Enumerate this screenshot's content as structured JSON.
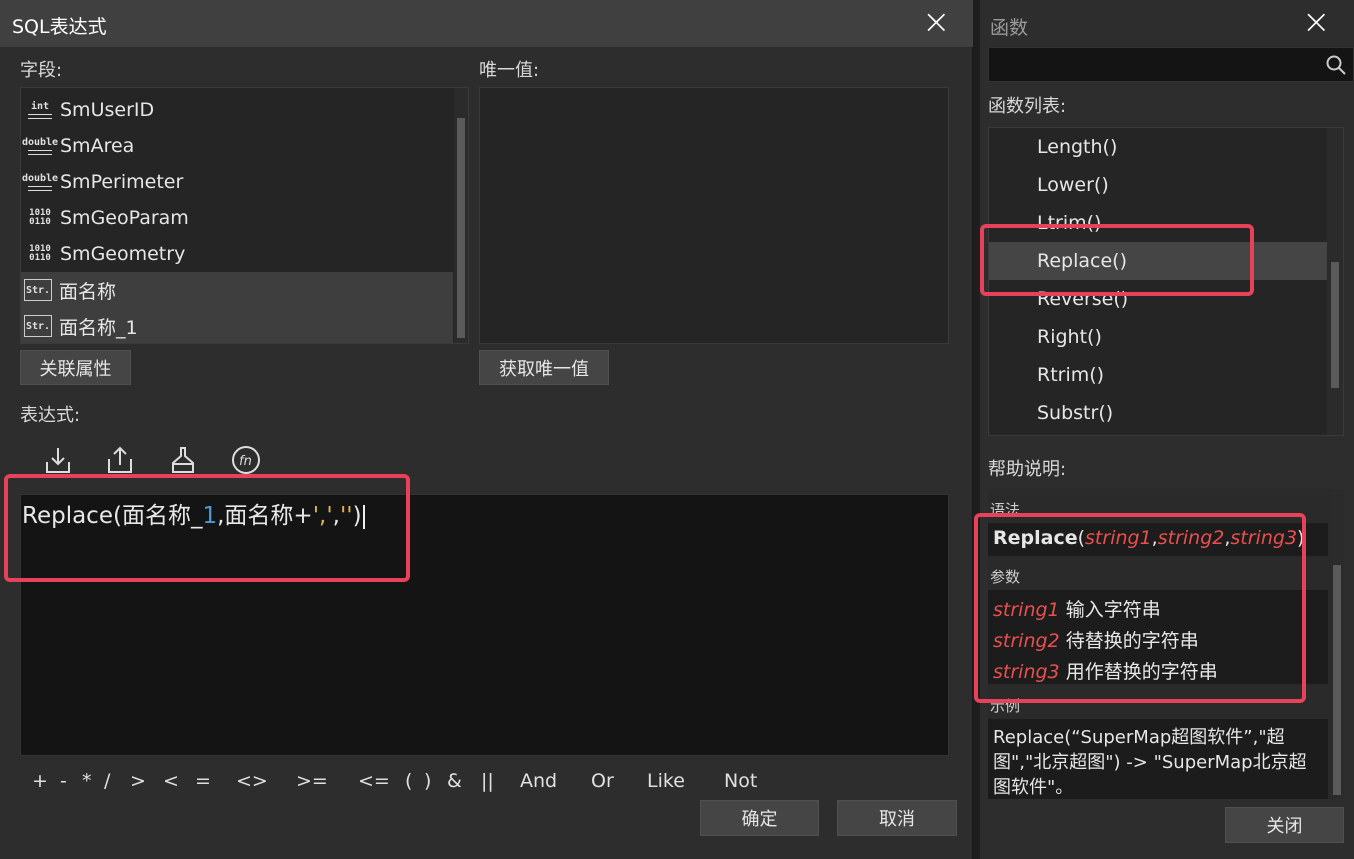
{
  "sql_dialog": {
    "title": "SQL表达式",
    "fields_label": "字段:",
    "unique_label": "唯一值:",
    "fields": [
      {
        "type_icon": "int-icon",
        "icon_text": "int",
        "name": "SmUserID"
      },
      {
        "type_icon": "double-icon",
        "icon_text": "double",
        "name": "SmArea"
      },
      {
        "type_icon": "double-icon",
        "icon_text": "double",
        "name": "SmPerimeter"
      },
      {
        "type_icon": "binary-icon",
        "icon_text": "1010 0110",
        "name": "SmGeoParam"
      },
      {
        "type_icon": "binary-icon",
        "icon_text": "1010 0110",
        "name": "SmGeometry"
      },
      {
        "type_icon": "string-icon",
        "icon_text": "Str.",
        "name": "面名称"
      },
      {
        "type_icon": "string-icon",
        "icon_text": "Str.",
        "name": "面名称_1"
      }
    ],
    "related_attr_button": "关联属性",
    "get_unique_button": "获取唯一值",
    "expression_label": "表达式:",
    "toolbar_icons": [
      "import-icon",
      "export-icon",
      "clear-icon",
      "function-icon"
    ],
    "expression": {
      "part1": "Replace(面名称_",
      "part2": "1",
      "part3": ",面名称+",
      "part4": "','",
      "part5": ",",
      "part6": "''",
      "part7": ")"
    },
    "operators": [
      "+",
      "-",
      "*",
      "/",
      ">",
      "<",
      "=",
      "<>",
      ">=",
      "<=",
      "(",
      ")",
      "&",
      "||",
      "And",
      "Or",
      "Like",
      "Not"
    ],
    "ok_button": "确定",
    "cancel_button": "取消"
  },
  "function_panel": {
    "title": "函数",
    "search_placeholder": "",
    "function_list_label": "函数列表:",
    "functions": [
      "Length()",
      "Lower()",
      "Ltrim()",
      "Replace()",
      "Reverse()",
      "Right()",
      "Rtrim()",
      "Substr()"
    ],
    "selected_function": "Replace()",
    "help_label": "帮助说明:",
    "help": {
      "syntax_label": "语法",
      "syntax_name": "Replace",
      "syntax_params": [
        "string1",
        "string2",
        "string3"
      ],
      "params_label": "参数",
      "params": [
        {
          "name": "string1",
          "desc": "输入字符串"
        },
        {
          "name": "string2",
          "desc": "待替换的字符串"
        },
        {
          "name": "string3",
          "desc": "用作替换的字符串"
        }
      ],
      "example_label": "示例",
      "example_lines": [
        "Replace(“SuperMap超图软件”,\"超",
        "图\",\"北京超图\") -> \"SuperMap北京超",
        "图软件\"。"
      ]
    },
    "close_button": "关闭"
  },
  "colors": {
    "highlight_red": "#e8425a",
    "param_red": "#e8504f",
    "number_blue": "#4a9bd8",
    "string_yellow": "#e0b050"
  }
}
